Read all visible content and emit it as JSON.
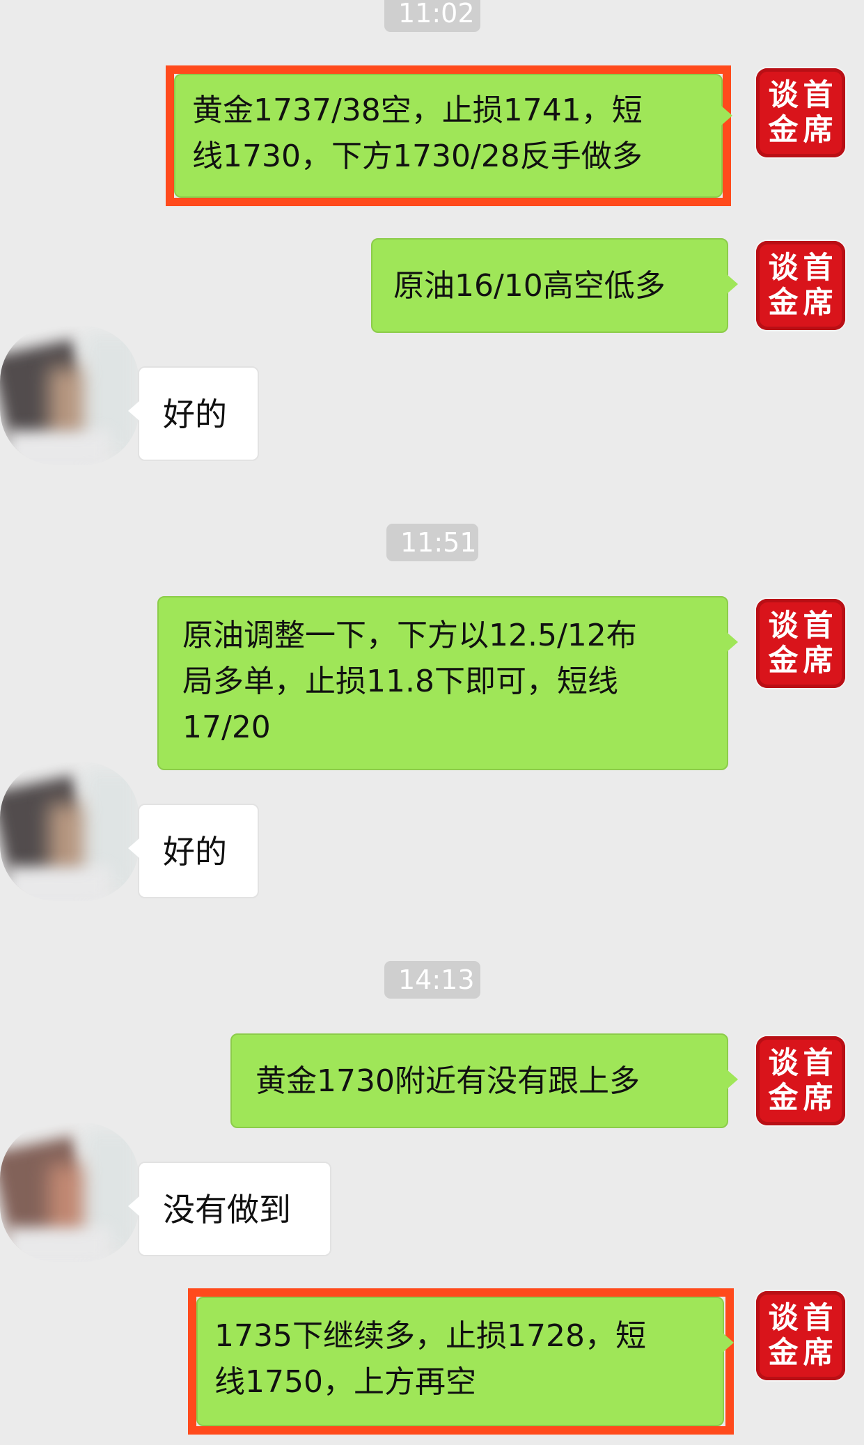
{
  "chat": {
    "time_1": "11:02",
    "time_2": "11:51",
    "time_3": "14:13",
    "seal_chars": [
      "谈",
      "首",
      "金",
      "席"
    ],
    "msg_1": "黄金1737/38空，止损1741，短\n线1730，下方1730/28反手做多",
    "msg_2": "原油16/10高空低多",
    "reply_1": "好的",
    "msg_3": "原油调整一下，下方以12.5/12布\n局多单，止损11.8下即可，短线\n17/20",
    "reply_2": "好的",
    "msg_4": "黄金1730附近有没有跟上多",
    "reply_3": "没有做到",
    "msg_5": "1735下继续多，止损1728，短\n线1750，上方再空"
  },
  "colors": {
    "background": "#ebebeb",
    "outgoing_bubble": "#9fe658",
    "incoming_bubble": "#ffffff",
    "highlight": "#ff4a1c",
    "seal": "#d9141b",
    "timestamp_bg": "#cfcfcf"
  }
}
